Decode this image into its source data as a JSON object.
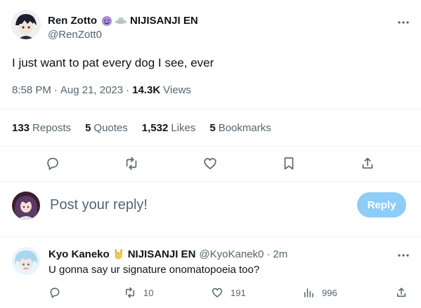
{
  "tweet": {
    "author_name": "Ren Zotto",
    "author_badge_text": "NIJISANJI EN",
    "handle": "@RenZott0",
    "text": "I just want to pat every dog I see, ever",
    "time": "8:58 PM",
    "date": "Aug 21, 2023",
    "views_count": "14.3K",
    "views_label": "Views",
    "emoji_icons": [
      "smiling-devil-icon",
      "ufo-icon"
    ]
  },
  "stats": {
    "reposts_count": "133",
    "reposts_label": "Reposts",
    "quotes_count": "5",
    "quotes_label": "Quotes",
    "likes_count": "1,532",
    "likes_label": "Likes",
    "bookmarks_count": "5",
    "bookmarks_label": "Bookmarks"
  },
  "composer": {
    "placeholder": "Post your reply!",
    "reply_button": "Reply"
  },
  "reply": {
    "author_name": "Kyo Kaneko",
    "author_badge_text": "NIJISANJI EN",
    "handle": "@KyoKanek0",
    "separator": "·",
    "time": "2m",
    "text": "U gonna say ur signature onomatopoeia too?",
    "retweets": "10",
    "likes": "191",
    "views": "996",
    "emoji_icon": "rock-on-hand-icon"
  },
  "colors": {
    "accent": "#1d9bf0",
    "reply_button_disabled": "#8ecdf8",
    "muted_text": "#536471",
    "divider": "#eff3f4"
  }
}
